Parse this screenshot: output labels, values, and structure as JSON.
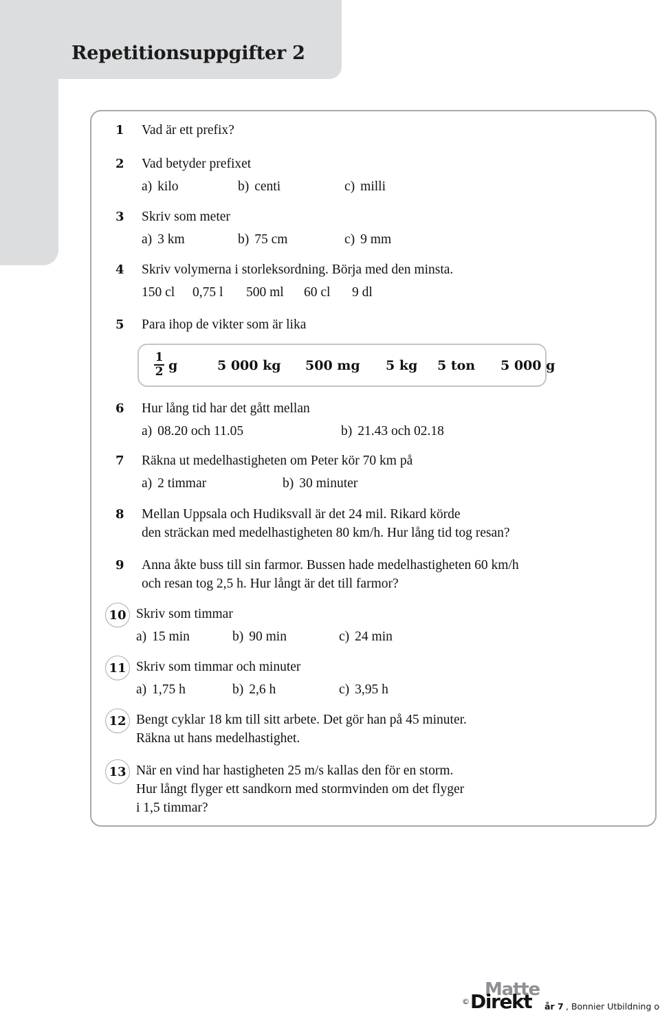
{
  "page": {
    "title": "Repetitionsuppgifter 2",
    "accent_gray": "#dcdddf",
    "border_gray": "#a7a8ac",
    "text_color": "#121212"
  },
  "exercises": [
    {
      "number": "1",
      "circled": false,
      "lines": [
        "Vad är ett prefix?"
      ],
      "subitems": []
    },
    {
      "number": "2",
      "circled": false,
      "lines": [
        "Vad betyder prefixet"
      ],
      "subitems": [
        {
          "label": "a)",
          "text": "kilo"
        },
        {
          "label": "b)",
          "text": "centi"
        },
        {
          "label": "c)",
          "text": "milli"
        }
      ]
    },
    {
      "number": "3",
      "circled": false,
      "lines": [
        "Skriv som meter"
      ],
      "subitems": [
        {
          "label": "a)",
          "text": "3 km"
        },
        {
          "label": "b)",
          "text": "75 cm"
        },
        {
          "label": "c)",
          "text": "9 mm"
        }
      ]
    },
    {
      "number": "4",
      "circled": false,
      "lines": [
        "Skriv volymerna i storleksordning. Börja med den minsta."
      ],
      "values": [
        "150 cl",
        "0,75 l",
        "500 ml",
        "60 cl",
        "9 dl"
      ],
      "subitems": []
    },
    {
      "number": "5",
      "circled": false,
      "lines": [
        "Para ihop de vikter som är lika"
      ],
      "weights": {
        "fraction": {
          "numerator": "1",
          "denominator": "2",
          "unit": "g"
        },
        "items": [
          "5 000 kg",
          "500 mg",
          "5 kg",
          "5 ton",
          "5 000 g"
        ]
      },
      "subitems": []
    },
    {
      "number": "6",
      "circled": false,
      "lines": [
        "Hur lång tid har det gått mellan"
      ],
      "subitems": [
        {
          "label": "a)",
          "text": "08.20 och 11.05"
        },
        {
          "label": "b)",
          "text": "21.43 och 02.18"
        }
      ]
    },
    {
      "number": "7",
      "circled": false,
      "lines": [
        "Räkna ut medelhastigheten om Peter kör 70 km på"
      ],
      "subitems": [
        {
          "label": "a)",
          "text": "2 timmar"
        },
        {
          "label": "b)",
          "text": "30 minuter"
        }
      ]
    },
    {
      "number": "8",
      "circled": false,
      "lines": [
        "Mellan Uppsala och Hudiksvall är det 24 mil. Rikard körde",
        "den sträckan med medelhastigheten 80 km/h. Hur lång tid tog resan?"
      ],
      "subitems": []
    },
    {
      "number": "9",
      "circled": false,
      "lines": [
        "Anna åkte buss till sin farmor. Bussen hade medelhastigheten 60 km/h",
        "och resan tog 2,5 h. Hur långt är det till farmor?"
      ],
      "subitems": []
    },
    {
      "number": "10",
      "circled": true,
      "lines": [
        "Skriv som timmar"
      ],
      "subitems": [
        {
          "label": "a)",
          "text": "15 min"
        },
        {
          "label": "b)",
          "text": "90 min"
        },
        {
          "label": "c)",
          "text": "24 min"
        }
      ]
    },
    {
      "number": "11",
      "circled": true,
      "lines": [
        "Skriv som timmar och minuter"
      ],
      "subitems": [
        {
          "label": "a)",
          "text": "1,75 h"
        },
        {
          "label": "b)",
          "text": "2,6 h"
        },
        {
          "label": "c)",
          "text": "3,95 h"
        }
      ]
    },
    {
      "number": "12",
      "circled": true,
      "lines": [
        "Bengt cyklar 18 km till sitt arbete. Det gör han på 45 minuter.",
        "Räkna ut hans medelhastighet."
      ],
      "subitems": []
    },
    {
      "number": "13",
      "circled": true,
      "lines": [
        "När en vind har hastigheten 25 m/s kallas den för en storm.",
        "Hur långt flyger ett sandkorn med stormvinden om det flyger",
        "i 1,5 timmar?"
      ],
      "subitems": []
    }
  ],
  "footer": {
    "copyright": "©",
    "logo_top": "Matte",
    "logo_bottom": "Direkt",
    "year": "år 7",
    "credit": ", Bonnier Utbildning och författarna",
    "logo_top_color": "#8e9094",
    "logo_bottom_color": "#141414"
  }
}
